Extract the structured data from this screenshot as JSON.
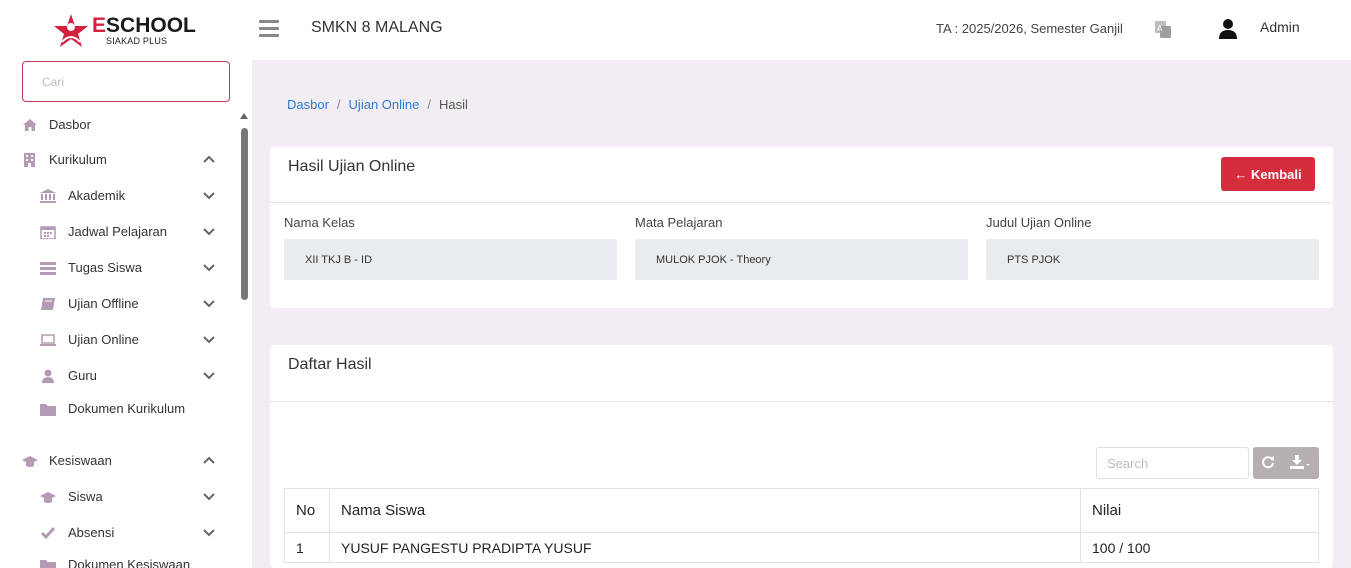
{
  "brand": {
    "title_first": "E",
    "title_rest": "SCHOOL",
    "subtitle": "SIAKAD PLUS"
  },
  "header": {
    "school_name": "SMKN 8 MALANG",
    "academic_year": "TA : 2025/2026, Semester Ganjil",
    "user_name": "Admin"
  },
  "sidebar": {
    "search_placeholder": "Cari",
    "items": [
      {
        "label": "Dasbor",
        "icon": "home-icon"
      },
      {
        "label": "Kurikulum",
        "icon": "building-icon",
        "expanded": true
      },
      {
        "label": "Akademik",
        "icon": "institution-icon"
      },
      {
        "label": "Jadwal Pelajaran",
        "icon": "calendar-icon"
      },
      {
        "label": "Tugas Siswa",
        "icon": "tasks-icon"
      },
      {
        "label": "Ujian Offline",
        "icon": "book-icon"
      },
      {
        "label": "Ujian Online",
        "icon": "laptop-icon"
      },
      {
        "label": "Guru",
        "icon": "user-icon"
      },
      {
        "label": "Dokumen Kurikulum",
        "icon": "folder-icon"
      },
      {
        "label": "Kesiswaan",
        "icon": "graduation-cap-icon",
        "expanded": true
      },
      {
        "label": "Siswa",
        "icon": "graduation-cap-icon"
      },
      {
        "label": "Absensi",
        "icon": "check-icon"
      },
      {
        "label": "Dokumen Kesiswaan",
        "icon": "folder-icon"
      }
    ]
  },
  "breadcrumb": {
    "home": "Dasbor",
    "parent": "Ujian Online",
    "current": "Hasil"
  },
  "info_card": {
    "title": "Hasil Ujian Online",
    "back_button": "Kembali",
    "fields": [
      {
        "label": "Nama Kelas",
        "value": "XII TKJ B - ID"
      },
      {
        "label": "Mata Pelajaran",
        "value": "MULOK PJOK - Theory"
      },
      {
        "label": "Judul Ujian Online",
        "value": "PTS PJOK"
      }
    ]
  },
  "results_card": {
    "title": "Daftar Hasil",
    "search_placeholder": "Search",
    "columns": [
      "No",
      "Nama Siswa",
      "Nilai"
    ],
    "rows": [
      {
        "no": "1",
        "name": "YUSUF PANGESTU PRADIPTA YUSUF",
        "score": "100 / 100"
      }
    ]
  },
  "colors": {
    "accent": "#d42e3d",
    "link": "#2d7bd4",
    "sidebar_icon": "#b49ab5",
    "background": "#f1edf3"
  }
}
